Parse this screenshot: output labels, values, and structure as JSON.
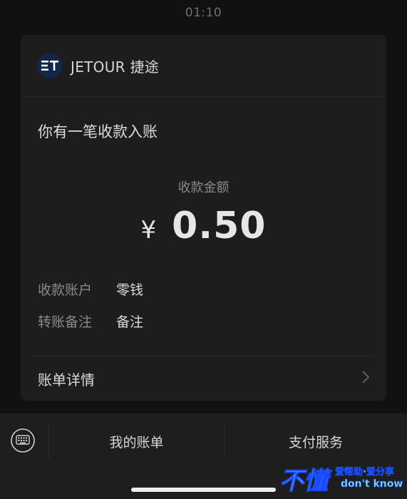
{
  "status_bar": {
    "time": "01:10"
  },
  "card": {
    "brand": "JETOUR 捷途",
    "notice_title": "你有一笔收款入账",
    "amount_label": "收款金额",
    "currency": "¥",
    "amount": "0.50",
    "rows": [
      {
        "label": "收款账户",
        "value": "零钱"
      },
      {
        "label": "转账备注",
        "value": "备注"
      }
    ],
    "detail_label": "账单详情"
  },
  "bottom_bar": {
    "tabs": [
      {
        "label": "我的账单"
      },
      {
        "label": "支付服务"
      }
    ]
  },
  "watermark": {
    "big": "不懂",
    "line1": "爱帮助·爱分享",
    "line2": "don't know"
  },
  "colors": {
    "background": "#111111",
    "card": "#1d1d1d",
    "bottom_bar": "#1e1e1e",
    "text_primary": "#dcdcdc",
    "text_secondary": "#8a8a8a",
    "logo_bg": "#12274a"
  },
  "icons": {
    "logo": "jetour-logo-icon",
    "detail": "chevron-right-icon",
    "keyboard": "keyboard-icon"
  }
}
